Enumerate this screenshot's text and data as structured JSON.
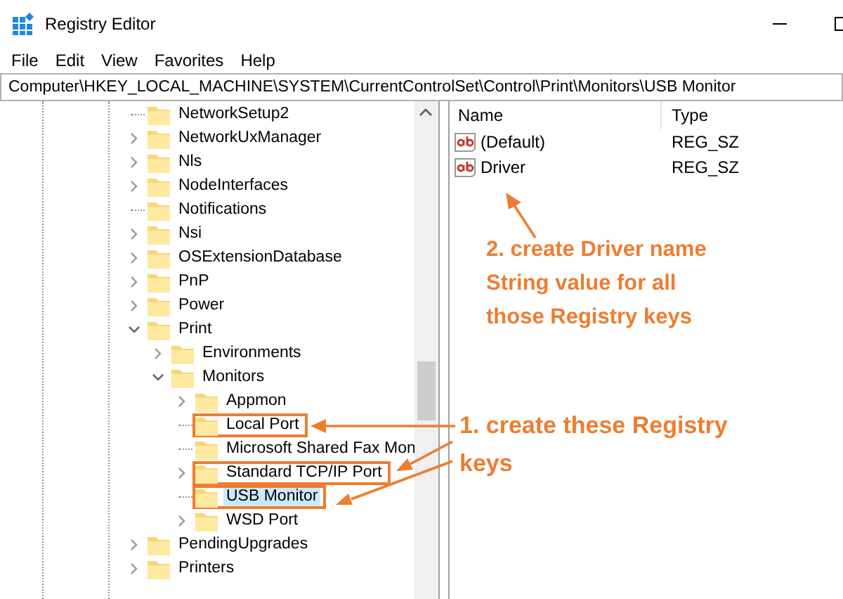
{
  "window": {
    "title": "Registry Editor"
  },
  "menu": [
    "File",
    "Edit",
    "View",
    "Favorites",
    "Help"
  ],
  "address": "Computer\\HKEY_LOCAL_MACHINE\\SYSTEM\\CurrentControlSet\\Control\\Print\\Monitors\\USB Monitor",
  "tree": [
    {
      "label": "NetworkSetup2",
      "kind": "leaf",
      "selected": false,
      "highlighted": false
    },
    {
      "label": "NetworkUxManager",
      "kind": "node",
      "expanded": false,
      "selected": false,
      "highlighted": false
    },
    {
      "label": "Nls",
      "kind": "node",
      "expanded": false,
      "selected": false,
      "highlighted": false
    },
    {
      "label": "NodeInterfaces",
      "kind": "node",
      "expanded": false,
      "selected": false,
      "highlighted": false
    },
    {
      "label": "Notifications",
      "kind": "leaf",
      "selected": false,
      "highlighted": false
    },
    {
      "label": "Nsi",
      "kind": "node",
      "expanded": false,
      "selected": false,
      "highlighted": false
    },
    {
      "label": "OSExtensionDatabase",
      "kind": "node",
      "expanded": false,
      "selected": false,
      "highlighted": false
    },
    {
      "label": "PnP",
      "kind": "node",
      "expanded": false,
      "selected": false,
      "highlighted": false
    },
    {
      "label": "Power",
      "kind": "node",
      "expanded": false,
      "selected": false,
      "highlighted": false
    },
    {
      "label": "Print",
      "kind": "node",
      "expanded": true,
      "selected": false,
      "highlighted": false,
      "children": [
        {
          "label": "Environments",
          "kind": "node",
          "expanded": false,
          "selected": false,
          "highlighted": false
        },
        {
          "label": "Monitors",
          "kind": "node",
          "expanded": true,
          "selected": false,
          "highlighted": false,
          "children": [
            {
              "label": "Appmon",
              "kind": "node",
              "expanded": false,
              "selected": false,
              "highlighted": false
            },
            {
              "label": "Local Port",
              "kind": "leaf",
              "selected": false,
              "highlighted": true
            },
            {
              "label": "Microsoft Shared Fax Mon",
              "kind": "leaf",
              "selected": false,
              "highlighted": false
            },
            {
              "label": "Standard TCP/IP Port",
              "kind": "node",
              "expanded": false,
              "selected": false,
              "highlighted": true
            },
            {
              "label": "USB Monitor",
              "kind": "leaf",
              "selected": true,
              "highlighted": true
            },
            {
              "label": "WSD Port",
              "kind": "node",
              "expanded": false,
              "selected": false,
              "highlighted": false
            }
          ]
        }
      ]
    },
    {
      "label": "PendingUpgrades",
      "kind": "node",
      "expanded": false,
      "selected": false,
      "highlighted": false
    },
    {
      "label": "Printers",
      "kind": "node",
      "expanded": false,
      "selected": false,
      "highlighted": false
    }
  ],
  "values": {
    "columns": [
      "Name",
      "Type"
    ],
    "rows": [
      {
        "name": "(Default)",
        "type": "REG_SZ"
      },
      {
        "name": "Driver",
        "type": "REG_SZ"
      }
    ]
  },
  "annotations": [
    {
      "lines": [
        "2. create Driver name",
        "String value for all",
        "those Registry keys"
      ]
    },
    {
      "lines": [
        "1. create these Registry",
        "keys"
      ]
    }
  ]
}
